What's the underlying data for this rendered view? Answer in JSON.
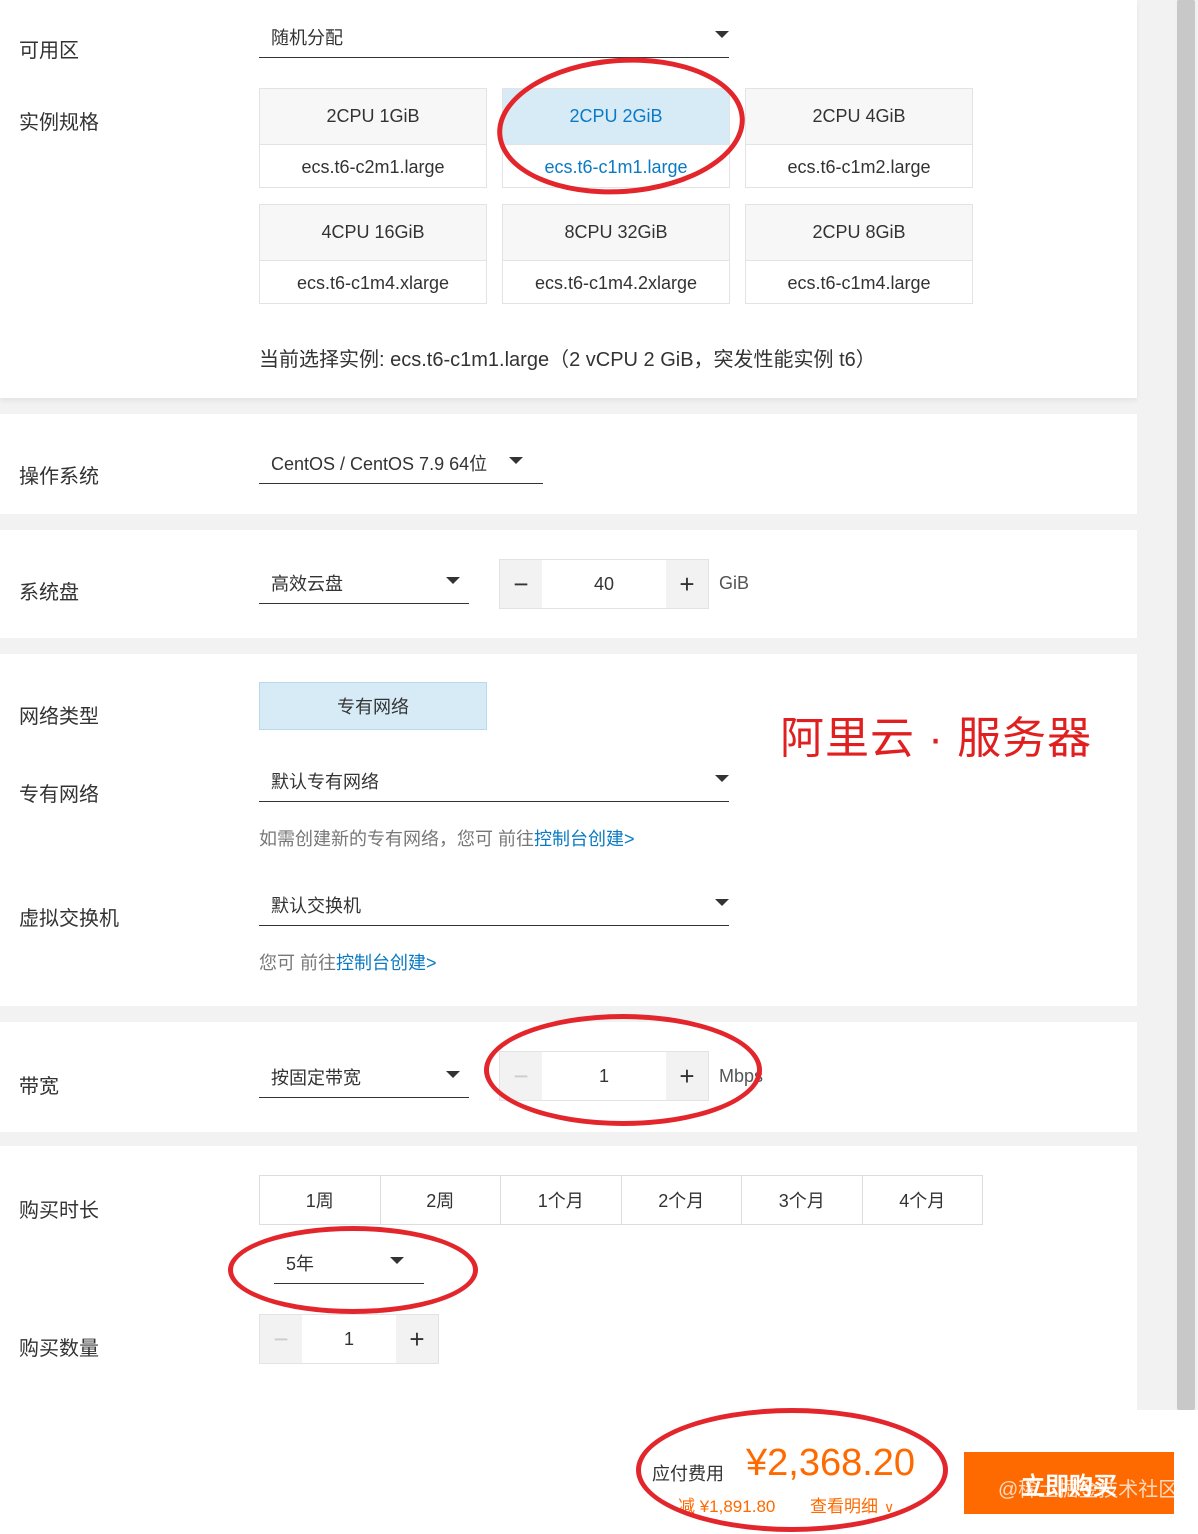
{
  "zone": {
    "label": "可用区",
    "value": "随机分配"
  },
  "instance": {
    "label": "实例规格",
    "cards": [
      {
        "spec": "2CPU 1GiB",
        "type": "ecs.t6-c2m1.large",
        "selected": false
      },
      {
        "spec": "2CPU 2GiB",
        "type": "ecs.t6-c1m1.large",
        "selected": true
      },
      {
        "spec": "2CPU 4GiB",
        "type": "ecs.t6-c1m2.large",
        "selected": false
      },
      {
        "spec": "4CPU 16GiB",
        "type": "ecs.t6-c1m4.xlarge",
        "selected": false
      },
      {
        "spec": "8CPU 32GiB",
        "type": "ecs.t6-c1m4.2xlarge",
        "selected": false
      },
      {
        "spec": "2CPU 8GiB",
        "type": "ecs.t6-c1m4.large",
        "selected": false
      }
    ],
    "current": "当前选择实例: ecs.t6-c1m1.large（2 vCPU 2 GiB，突发性能实例 t6）"
  },
  "os": {
    "label": "操作系统",
    "value": "CentOS / CentOS 7.9 64位"
  },
  "disk": {
    "label": "系统盘",
    "type": "高效云盘",
    "size": "40",
    "unit": "GiB"
  },
  "network": {
    "type_label": "网络类型",
    "type_value": "专有网络",
    "vpc_label": "专有网络",
    "vpc_value": "默认专有网络",
    "vpc_hint": "如需创建新的专有网络，您可 前往",
    "vpc_link": "控制台创建>",
    "vswitch_label": "虚拟交换机",
    "vswitch_value": "默认交换机",
    "vswitch_hint": "您可 前往",
    "vswitch_link": "控制台创建>"
  },
  "annotation_title": "阿里云 · 服务器",
  "bandwidth": {
    "label": "带宽",
    "mode": "按固定带宽",
    "value": "1",
    "unit": "Mbps"
  },
  "duration": {
    "label": "购买时长",
    "options": [
      "1周",
      "2周",
      "1个月",
      "2个月",
      "3个月",
      "4个月"
    ],
    "selected_value": "5年"
  },
  "quantity": {
    "label": "购买数量",
    "value": "1"
  },
  "footer": {
    "fee_label": "应付费用",
    "amount": "¥2,368.20",
    "discount": "减 ¥1,891.80",
    "detail": "查看明细",
    "buy": "立即购买",
    "watermark": "@稀土掘金技术社区"
  },
  "colors": {
    "accent": "#ff6a00",
    "link": "#0a7ac4",
    "selected_bg": "#d7ebf7",
    "annotation": "#e3262c"
  },
  "icons": {
    "caret": "caret-down-icon",
    "minus": "minus-icon",
    "plus": "plus-icon",
    "chevron": "chevron-down-icon"
  }
}
